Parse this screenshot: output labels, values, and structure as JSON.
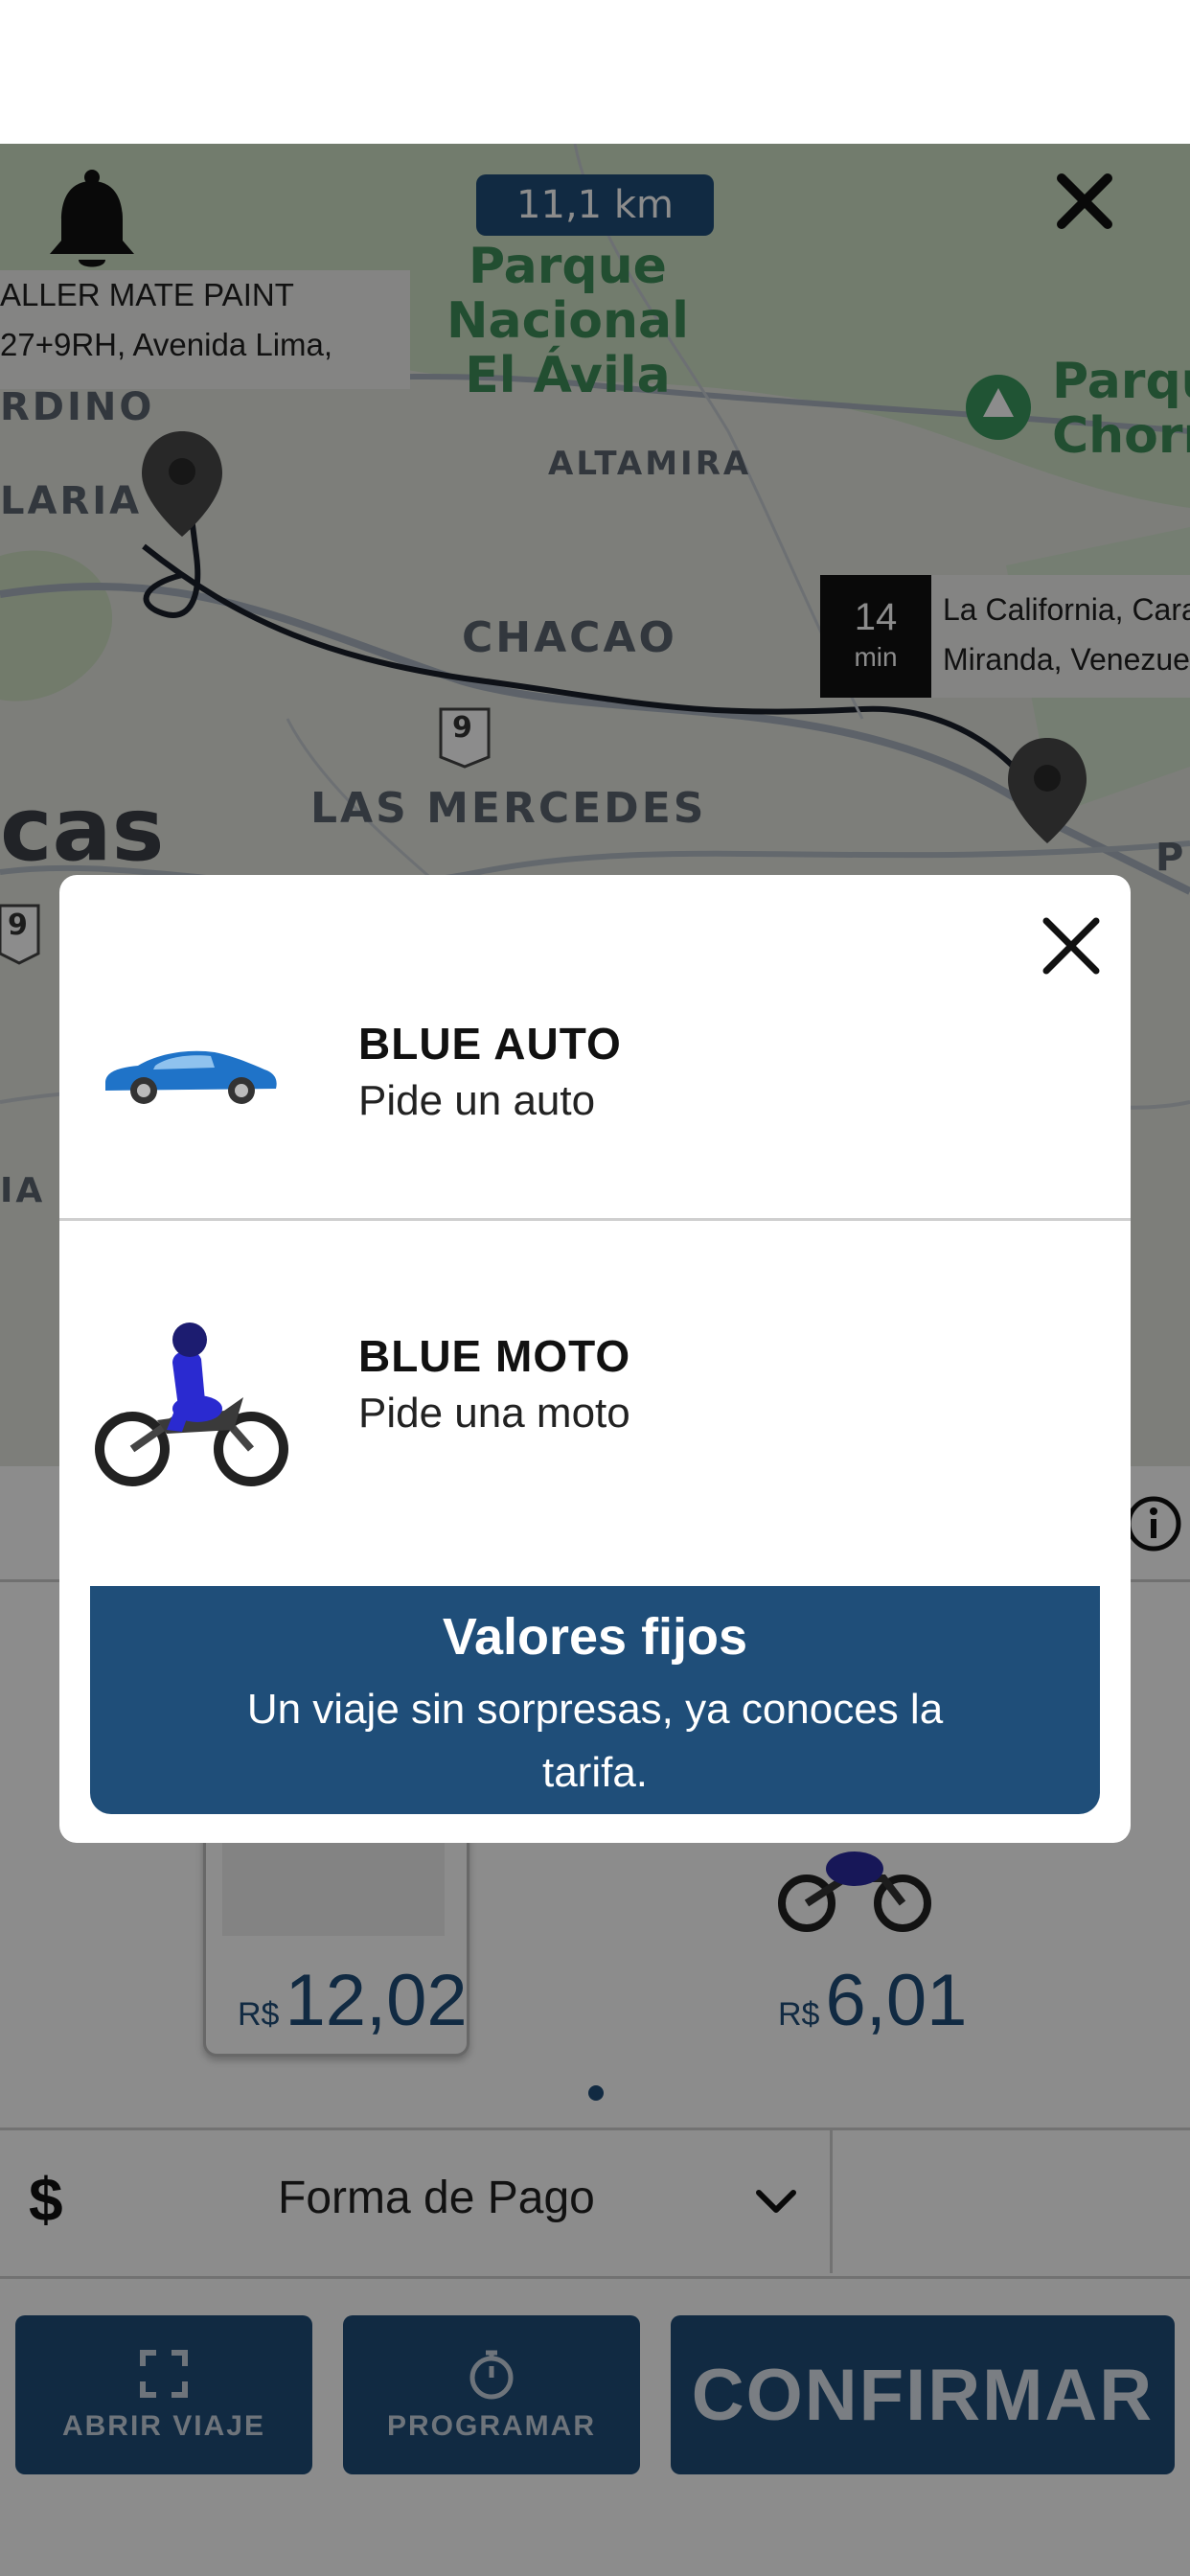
{
  "map": {
    "distance": "11,1 km",
    "origin_lines": [
      "ALLER MATE PAINT",
      "27+9RH, Avenida Lima,"
    ],
    "destination_time": "14",
    "destination_time_unit": "min",
    "destination_lines": [
      "La California, Caracas",
      "Miranda, Venezuela"
    ],
    "labels": {
      "park1": "Parque\nNacional\nEl Ávila",
      "park2": "Parqu\nChorr",
      "altamira": "ALTAMIRA",
      "chacao": "CHACAO",
      "las_mercedes": "LAS MERCEDES",
      "dino": "RDINO",
      "laria": "LARIA",
      "cas": "cas",
      "ia": "IA",
      "p": "P",
      "road9a": "9",
      "road9b": "9"
    }
  },
  "modal": {
    "options": [
      {
        "title": "BLUE AUTO",
        "subtitle": "Pide un auto"
      },
      {
        "title": "BLUE MOTO",
        "subtitle": "Pide una moto"
      }
    ],
    "banner_title": "Valores fijos",
    "banner_text": "Un viaje sin sorpresas, ya conoces la tarifa."
  },
  "sheet": {
    "prices": [
      {
        "currency": "R$",
        "value": "12,02"
      },
      {
        "currency": "R$",
        "value": "6,01"
      }
    ],
    "payment_symbol": "$",
    "payment_label": "Forma de Pago",
    "buttons": {
      "open_trip": "ABRIR VIAJE",
      "schedule": "PROGRAMAR",
      "confirm": "CONFIRMAR"
    }
  },
  "colors": {
    "brand": "#1f4e79",
    "overlay": "rgba(0,0,0,0.45)"
  }
}
